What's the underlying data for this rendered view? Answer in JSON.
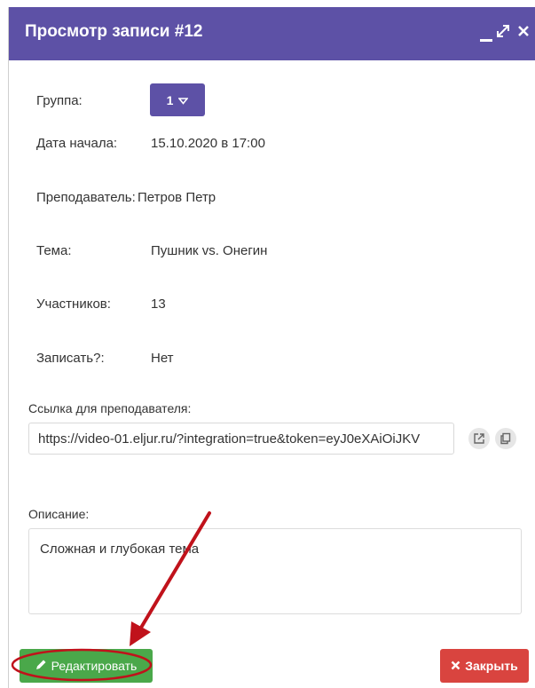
{
  "window": {
    "title": "Просмотр записи #12"
  },
  "fields": {
    "group_label": "Группа:",
    "group_value": "1",
    "start_label": "Дата начала:",
    "start_value": "15.10.2020 в 17:00",
    "teacher_label": "Преподаватель:",
    "teacher_value": "Петров Петр",
    "topic_label": "Тема:",
    "topic_value": "Пушник vs. Онегин",
    "participants_label": "Участников:",
    "participants_value": "13",
    "record_label": "Записать?:",
    "record_value": "Нет"
  },
  "link": {
    "label": "Ссылка для преподавателя:",
    "value": "https://video-01.eljur.ru/?integration=true&token=eyJ0eXAiOiJKV"
  },
  "description": {
    "label": "Описание:",
    "value": "Сложная и глубокая тема"
  },
  "buttons": {
    "edit_label": "Редактировать",
    "close_label": "Закрыть"
  },
  "colors": {
    "titlebar": "#5d51a6",
    "edit": "#4aa84a",
    "close": "#d9443f",
    "annotation": "#c0121b"
  },
  "icons": [
    "minimize-icon",
    "maximize-icon",
    "close-icon",
    "chevron-down-icon",
    "external-link-icon",
    "copy-icon",
    "pencil-icon",
    "x-icon"
  ]
}
